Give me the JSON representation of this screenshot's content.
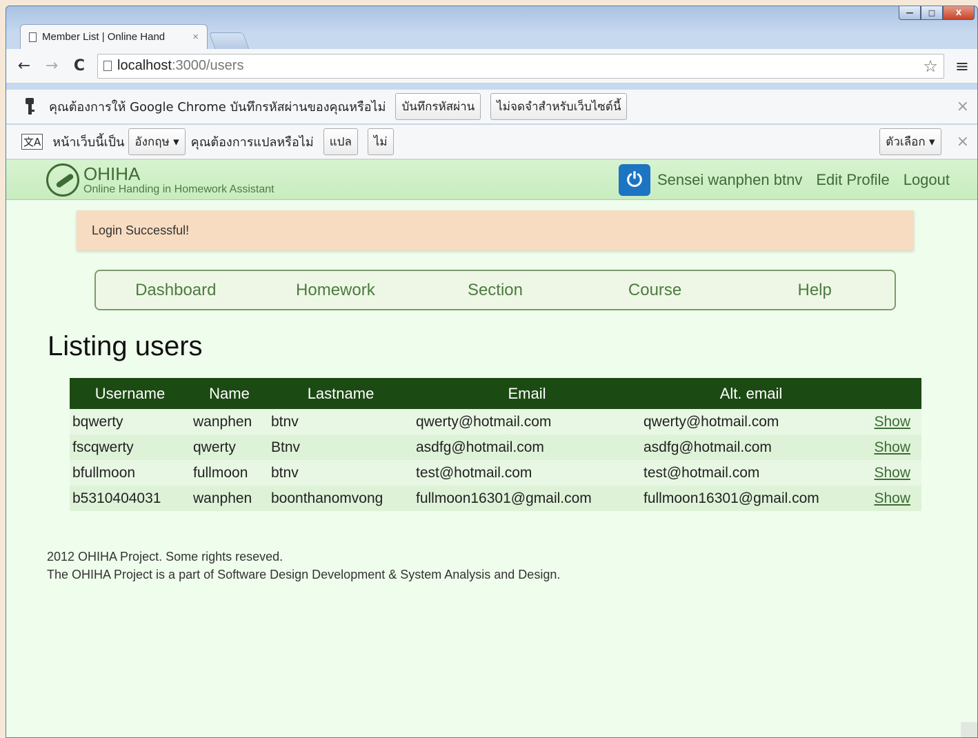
{
  "browser": {
    "tab_title": "Member List | Online Hand",
    "tab_close": "×",
    "url_host": "localhost",
    "url_path": ":3000/users",
    "nav": {
      "back": "←",
      "forward": "→",
      "reload": "C"
    },
    "star": "☆",
    "menu": "≡",
    "window_buttons": {
      "minimize": "—",
      "maximize": "□",
      "close": "X"
    }
  },
  "password_bar": {
    "message": "คุณต้องการให้ Google Chrome บันทึกรหัสผ่านของคุณหรือไม่",
    "save_button": "บันทึกรหัสผ่าน",
    "never_button": "ไม่จดจำสำหรับเว็บไซต์นี้",
    "close": "×",
    "icon": "key-icon"
  },
  "translate_bar": {
    "icon_text": "文A",
    "prefix": "หน้าเว็บนี้เป็น",
    "language": "อังกฤษ ▾",
    "question": "คุณต้องการแปลหรือไม่",
    "translate_button": "แปล",
    "no_button": "ไม่",
    "options_button": "ตัวเลือก ▾",
    "close": "×"
  },
  "site": {
    "logo_title": "OHIHA",
    "logo_subtitle": "Online Handing in Homework Assistant",
    "power_glyph": "⏻",
    "user_link": "Sensei wanphen btnv",
    "edit_profile": "Edit Profile",
    "logout": "Logout",
    "accent_color": "#3f6b35"
  },
  "flash": "Login Successful!",
  "mainnav": [
    "Dashboard",
    "Homework",
    "Section",
    "Course",
    "Help"
  ],
  "page_title": "Listing users",
  "table": {
    "headers": [
      "Username",
      "Name",
      "Lastname",
      "Email",
      "Alt. email",
      ""
    ],
    "rows": [
      [
        "bqwerty",
        "wanphen",
        "btnv",
        "qwerty@hotmail.com",
        "qwerty@hotmail.com",
        "Show"
      ],
      [
        "fscqwerty",
        "qwerty",
        "Btnv",
        "asdfg@hotmail.com",
        "asdfg@hotmail.com",
        "Show"
      ],
      [
        "bfullmoon",
        "fullmoon",
        "btnv",
        "test@hotmail.com",
        "test@hotmail.com",
        "Show"
      ],
      [
        "b5310404031",
        "wanphen",
        "boonthanomvong",
        "fullmoon16301@gmail.com",
        "fullmoon16301@gmail.com",
        "Show"
      ]
    ]
  },
  "footer": {
    "line1": "2012 OHIHA Project. Some rights reseved.",
    "line2": "The OHIHA Project is a part of Software Design Development & System Analysis and Design."
  }
}
